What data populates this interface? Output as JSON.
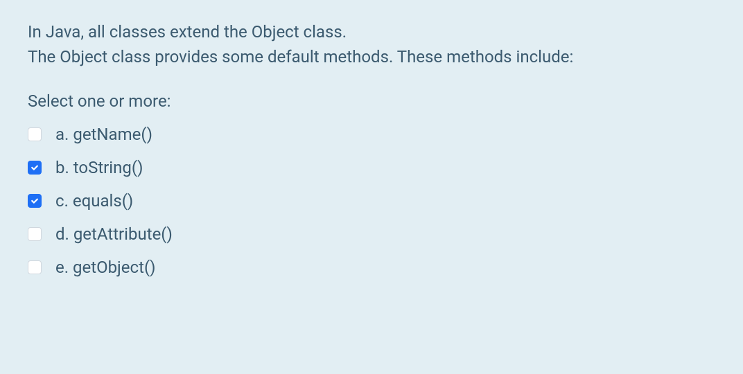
{
  "question": {
    "line1": "In Java, all classes extend the Object class.",
    "line2": "The Object class provides some default methods. These methods include:"
  },
  "prompt": "Select one or more:",
  "options": [
    {
      "letter": "a.",
      "text": "getName()",
      "checked": false
    },
    {
      "letter": "b.",
      "text": "toString()",
      "checked": true
    },
    {
      "letter": "c.",
      "text": "equals()",
      "checked": true
    },
    {
      "letter": "d.",
      "text": "getAttribute()",
      "checked": false
    },
    {
      "letter": "e.",
      "text": "getObject()",
      "checked": false
    }
  ]
}
